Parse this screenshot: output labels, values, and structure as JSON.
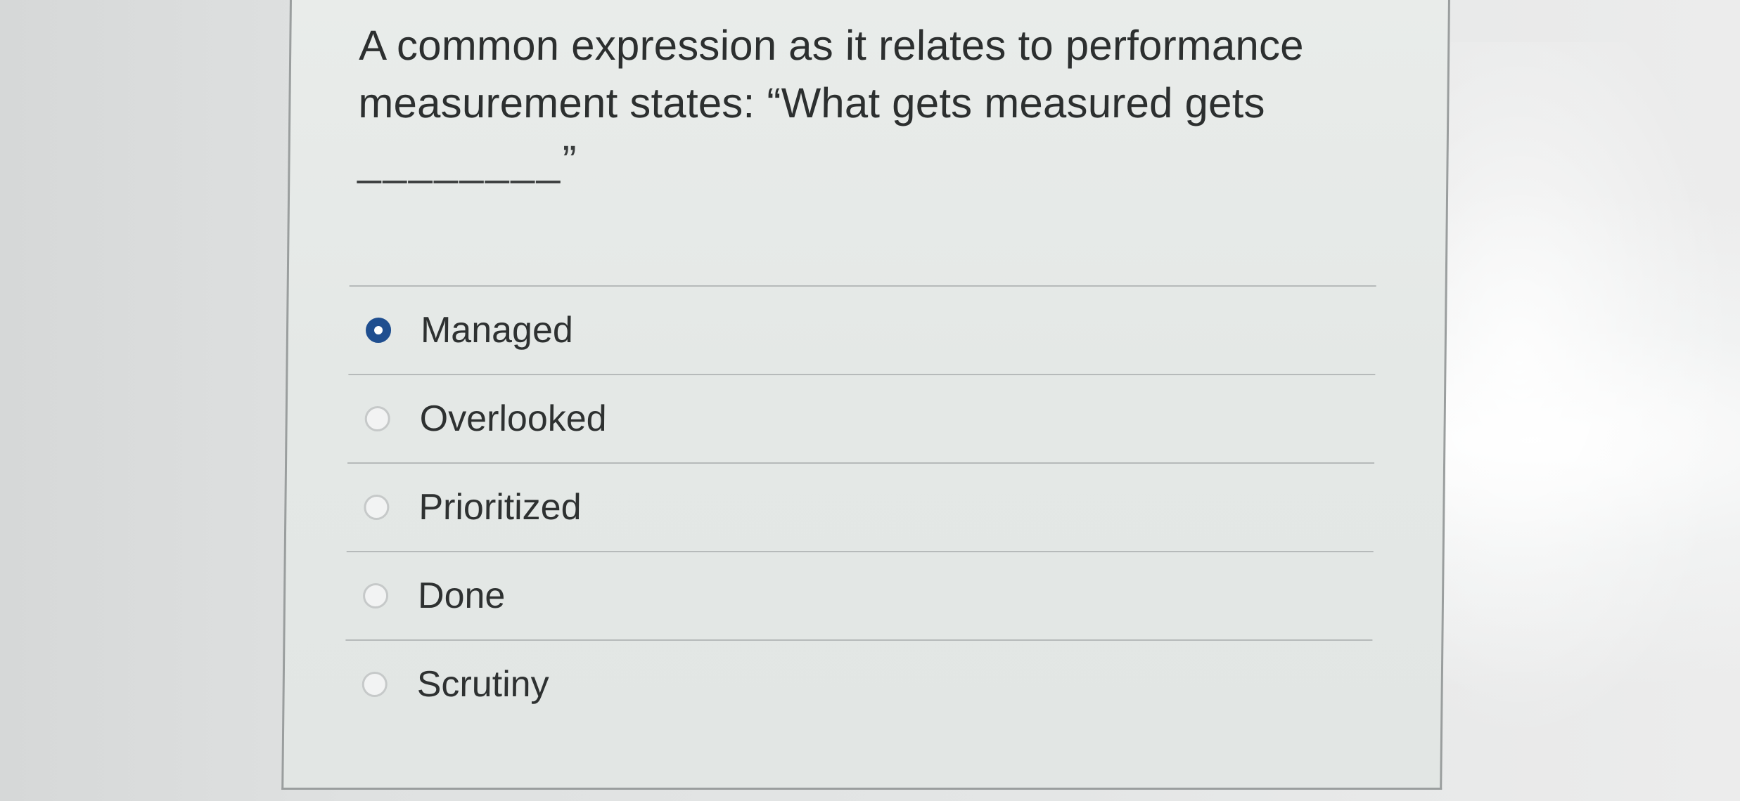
{
  "question": {
    "text": "A common expression as it relates to performance measurement states: “What gets measured gets",
    "blank": "________”"
  },
  "options": [
    {
      "label": "Managed",
      "selected": true
    },
    {
      "label": "Overlooked",
      "selected": false
    },
    {
      "label": "Prioritized",
      "selected": false
    },
    {
      "label": "Done",
      "selected": false
    },
    {
      "label": "Scrutiny",
      "selected": false
    }
  ],
  "colors": {
    "selected_radio": "#1f4e8f",
    "text": "#2c2f2f",
    "card_background": "#e6e9e8"
  }
}
